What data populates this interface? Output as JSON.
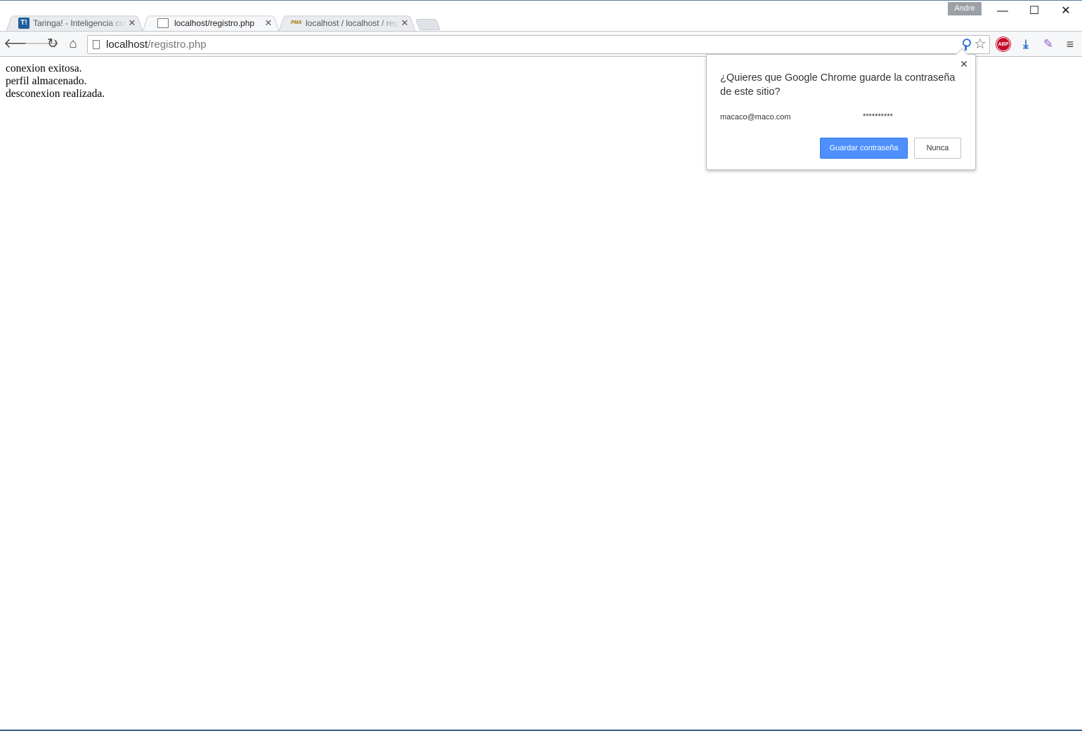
{
  "window": {
    "profile_name": "Andre",
    "minimize_glyph": "—",
    "maximize_glyph": "☐",
    "close_glyph": "✕"
  },
  "tabs": [
    {
      "title": "Taringa! - Inteligencia cole",
      "favicon": "taringa-icon",
      "favicon_text": "T!",
      "active": false
    },
    {
      "title": "localhost/registro.php",
      "favicon": "page-icon",
      "active": true
    },
    {
      "title": "localhost / localhost / regi",
      "favicon": "phpmyadmin-icon",
      "favicon_text": "PMA",
      "active": false
    }
  ],
  "tab_close_glyph": "✕",
  "toolbar": {
    "back_glyph": "🡐",
    "forward_glyph": "🡒",
    "reload_glyph": "↻",
    "home_glyph": "⌂",
    "url_host": "localhost",
    "url_path": "/registro.php",
    "star_glyph": "☆",
    "abp_label": "ABP",
    "download_glyph": "⤓",
    "feather_glyph": "✎",
    "menu_glyph": "≡"
  },
  "page": {
    "lines": [
      "conexion exitosa.",
      "perfil almacenado.",
      "desconexion realizada."
    ]
  },
  "password_bubble": {
    "title": "¿Quieres que Google Chrome guarde la contraseña de este sitio?",
    "username": "macaco@maco.com",
    "password_mask": "**********",
    "save_label": "Guardar contraseña",
    "never_label": "Nunca",
    "close_glyph": "✕"
  },
  "colors": {
    "accent_blue": "#4d90fe",
    "abp_red": "#c70d2c",
    "taringa_blue": "#1f5e9c"
  }
}
